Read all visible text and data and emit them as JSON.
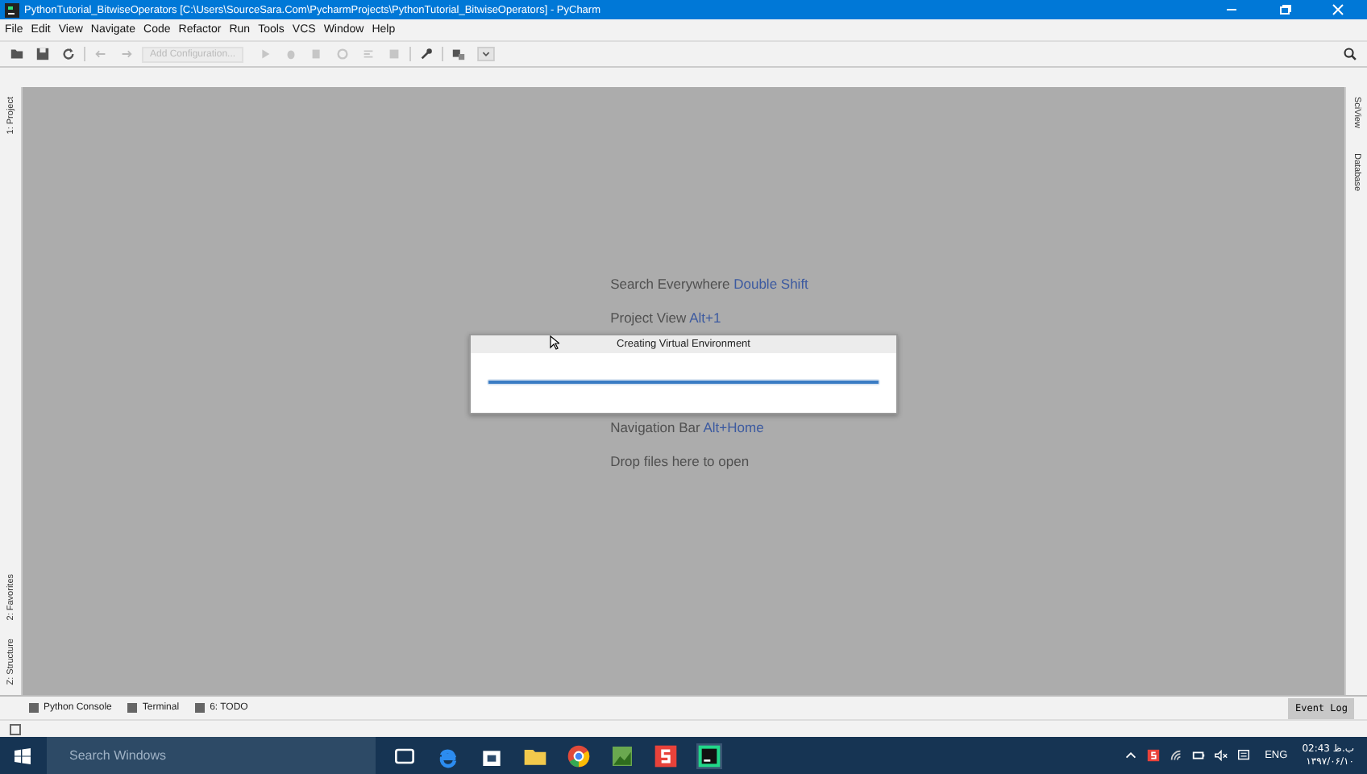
{
  "window": {
    "title": "PythonTutorial_BitwiseOperators [C:\\Users\\SourceSara.Com\\PycharmProjects\\PythonTutorial_BitwiseOperators] - PyCharm"
  },
  "menu": [
    "File",
    "Edit",
    "View",
    "Navigate",
    "Code",
    "Refactor",
    "Run",
    "Tools",
    "VCS",
    "Window",
    "Help"
  ],
  "toolbar": {
    "run_configuration": "Add Configuration..."
  },
  "left_strip": {
    "top": [
      "1: Project"
    ],
    "bottom": [
      "2: Favorites",
      "Z: Structure"
    ]
  },
  "right_strip": [
    "SciView",
    "Database"
  ],
  "hints": [
    {
      "text": "Search Everywhere",
      "shortcut": "Double Shift"
    },
    {
      "text": "Project View",
      "shortcut": "Alt+1"
    },
    {
      "text": "Navigation Bar",
      "shortcut": "Alt+Home"
    },
    {
      "text": "Drop files here to open"
    }
  ],
  "dialog": {
    "title": "Creating Virtual Environment",
    "progress": {
      "level": 1
    }
  },
  "bottom_tools": [
    "Python Console",
    "Terminal",
    "6: TODO"
  ],
  "event_log": "Event Log",
  "taskbar": {
    "search": "Search Windows",
    "language": "ENG",
    "time": "02:43 ب.ظ",
    "date": "۱۳۹۷/۰۶/۱۰"
  }
}
